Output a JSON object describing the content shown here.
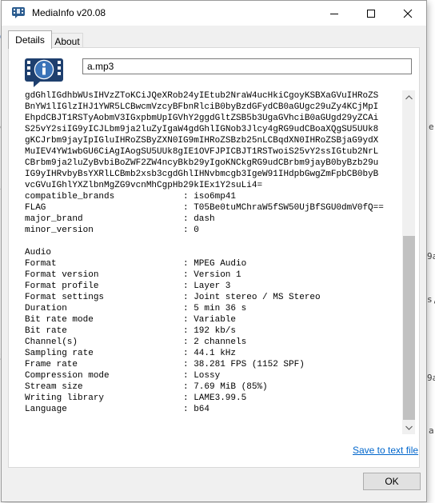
{
  "window": {
    "title": "MediaInfo v20.08"
  },
  "tabs": [
    {
      "label": "Details",
      "active": true
    },
    {
      "label": "About",
      "active": false
    }
  ],
  "file_field": {
    "value": "a.mp3"
  },
  "info_lines": [
    {
      "text": "gdGhlIGdhbWUsIHVzZToKCiJQeXRob24yIEtub2NraW4ucHkiCgoyKSBXaGVuIHRoZS"
    },
    {
      "text": "BnYW1lIGlzIHJ1YWR5LCBwcmVzcyBFbnRlciB0byBzdGFydCB0aGUgc29uZy4KCjMpI"
    },
    {
      "text": "EhpdCBJT1RSTyAobmV3IGxpbmUpIGVhY2ggdGltZSB5b3UgaGVhciB0aGUgd29yZCAi"
    },
    {
      "text": "S25vY2siIG9yICJLbm9ja2luZyIgaW4gdGhlIGNob3Jlcy4gRG9udCBoaXQgSU5UUk8"
    },
    {
      "text": "gKCJrbm9jayIpIGluIHRoZSByZXN0IG9mIHRoZSBzb25nLCBqdXN0IHRoZSBjaG9ydX"
    },
    {
      "text": "MuIEV4YW1wbGU6CiAgIAogSU5UUk8gIE1OVFJPICBJT1RSTwoiS25vY2ssIGtub2NrL"
    },
    {
      "text": "CBrbm9ja2luZyBvbiBoZWF2ZW4ncyBkb29yIgoKNCkgRG9udCBrbm9jayB0byBzb29u"
    },
    {
      "text": "IG9yIHRvbyBsYXRlLCBmb2xsb3cgdGhlIHNvbmcgb3IgeW91IHdpbGwgZmFpbCB0byB"
    },
    {
      "text": "vcGVuIGhlYXZlbnMgZG9vcnMhCgpHb29kIEx1Y2suLi4="
    },
    {
      "key": "compatible_brands",
      "value": "iso6mp41"
    },
    {
      "key": "FLAG",
      "value": "T05Be0tuMChraW5fSW50UjBfSGU0dmV0fQ=="
    },
    {
      "key": "major_brand",
      "value": "dash"
    },
    {
      "key": "minor_version",
      "value": "0"
    },
    {
      "text": ""
    },
    {
      "text": "Audio"
    },
    {
      "key": "Format",
      "value": "MPEG Audio"
    },
    {
      "key": "Format version",
      "value": "Version 1"
    },
    {
      "key": "Format profile",
      "value": "Layer 3"
    },
    {
      "key": "Format settings",
      "value": "Joint stereo / MS Stereo"
    },
    {
      "key": "Duration",
      "value": "5 min 36 s"
    },
    {
      "key": "Bit rate mode",
      "value": "Variable"
    },
    {
      "key": "Bit rate",
      "value": "192 kb/s"
    },
    {
      "key": "Channel(s)",
      "value": "2 channels"
    },
    {
      "key": "Sampling rate",
      "value": "44.1 kHz"
    },
    {
      "key": "Frame rate",
      "value": "38.281 FPS (1152 SPF)"
    },
    {
      "key": "Compression mode",
      "value": "Lossy"
    },
    {
      "key": "Stream size",
      "value": "7.69 MiB (85%)"
    },
    {
      "key": "Writing library",
      "value": "LAME3.99.5"
    },
    {
      "key": "Language",
      "value": "b64"
    }
  ],
  "save_link": {
    "label": "Save to text file"
  },
  "ok_button": {
    "label": "OK"
  },
  "background_fragments": [
    "G",
    "e",
    "e",
    "/",
    "9a",
    "s,",
    "3",
    ")",
    "9a",
    "a"
  ],
  "colors": {
    "link": "#0066cc",
    "accent": "#1e3f6e"
  },
  "icons": {
    "app": "mediainfo-icon",
    "logo": "mediainfo-logo-icon"
  }
}
